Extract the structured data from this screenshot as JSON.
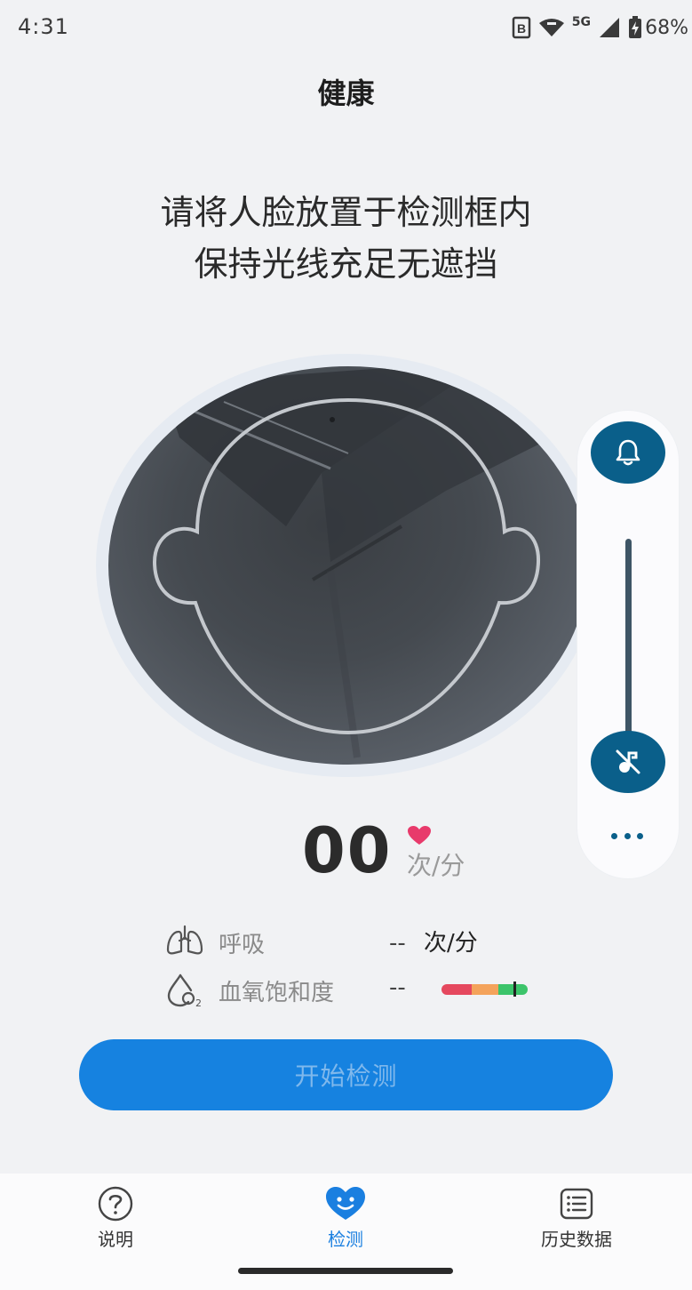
{
  "status_bar": {
    "time": "4:31",
    "network": "5G",
    "battery": "68%"
  },
  "header": {
    "title": "健康"
  },
  "instructions": {
    "line1": "请将人脸放置于检测框内",
    "line2": "保持光线充足无遮挡"
  },
  "side_panel": {
    "bell_icon": "bell-icon",
    "mute_icon": "music-off-icon",
    "more_icon": "more-horizontal-icon",
    "volume_level": 0
  },
  "heart_rate": {
    "value": "00",
    "unit": "次/分",
    "icon": "heart-icon"
  },
  "metrics": {
    "respiration": {
      "icon": "lungs-icon",
      "label": "呼吸",
      "value": "--",
      "unit": "次/分"
    },
    "oxygen": {
      "icon": "oxygen-drop-icon",
      "label": "血氧饱和度",
      "value": "--",
      "scale_colors": [
        "#e5485e",
        "#f4a35b",
        "#3cc46a"
      ]
    }
  },
  "start_button": {
    "label": "开始检测",
    "enabled": false
  },
  "bottom_nav": {
    "items": [
      {
        "label": "说明",
        "icon": "question-circle-icon",
        "active": false
      },
      {
        "label": "检测",
        "icon": "heart-smile-icon",
        "active": true
      },
      {
        "label": "历史数据",
        "icon": "list-icon",
        "active": false
      }
    ]
  },
  "colors": {
    "accent": "#1682e0",
    "control": "#0a5f8a",
    "background": "#f1f2f4"
  }
}
